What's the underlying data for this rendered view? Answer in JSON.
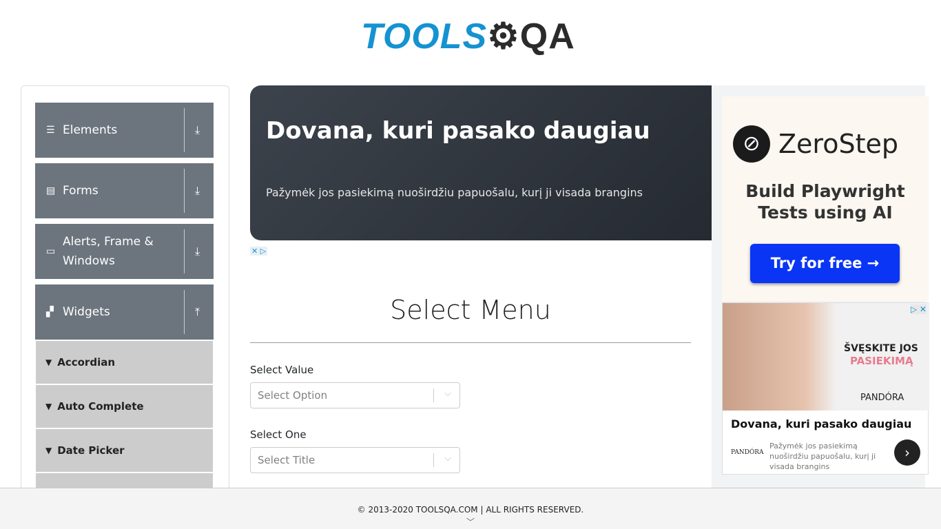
{
  "logo": {
    "part1": "TOOLS",
    "part2": "QA"
  },
  "sidebar": {
    "groups": [
      {
        "label": "Elements",
        "icon": "hamburger-icon"
      },
      {
        "label": "Forms",
        "icon": "document-icon"
      },
      {
        "label": "Alerts, Frame & Windows",
        "icon": "window-icon"
      },
      {
        "label": "Widgets",
        "icon": "widgets-icon"
      }
    ],
    "items": [
      {
        "label": "Accordian"
      },
      {
        "label": "Auto Complete"
      },
      {
        "label": "Date Picker"
      }
    ]
  },
  "banner_ad": {
    "title": "Dovana, kuri pasako daugiau",
    "text": "Pažymėk jos pasiekimą nuoširdžiu papuošalu, kurį ji visada brangins",
    "controls": "✕ ▷"
  },
  "main": {
    "title": "Select Menu",
    "select_value_label": "Select Value",
    "select_value_placeholder": "Select Option",
    "select_one_label": "Select One",
    "select_one_placeholder": "Select Title"
  },
  "zerostep_ad": {
    "brand": "ZeroStep",
    "tagline_1": "Build Playwright",
    "tagline_2": "Tests using AI",
    "button": "Try for free →"
  },
  "pandora_ad": {
    "controls": "▷ ✕",
    "headline_1": "ŠVĘSKITE JOS",
    "headline_2": "PASIEKIMĄ",
    "brand": "PANDÓRA",
    "title": "Dovana, kuri pasako daugiau",
    "brand_small": "PANDÓRA",
    "description": "Pažymėk jos pasiekimą nuoširdžiu papuošalu, kurį ji visada brangins"
  },
  "footer": {
    "text": "© 2013-2020 TOOLSQA.COM | ALL RIGHTS RESERVED."
  }
}
